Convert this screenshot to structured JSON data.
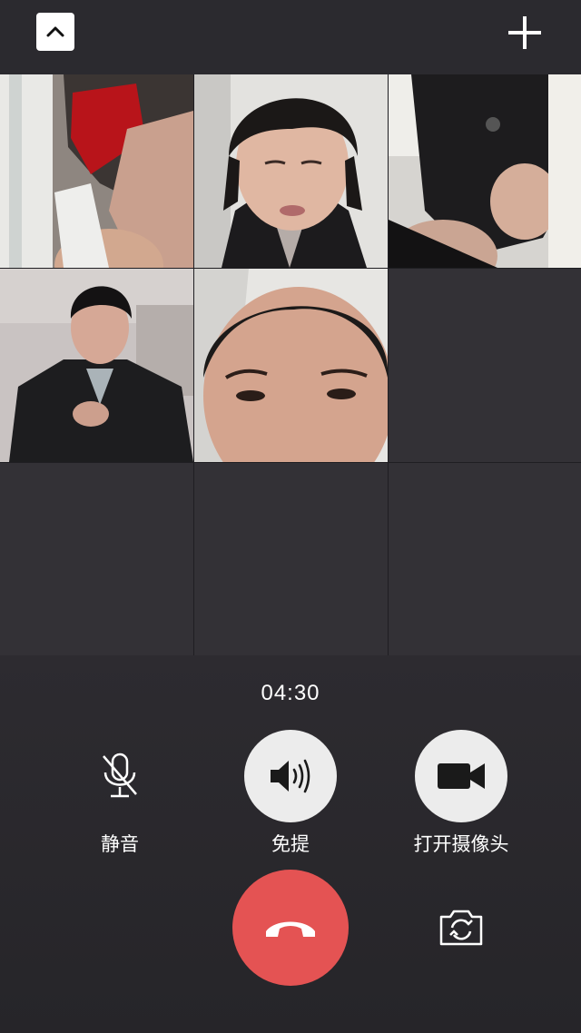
{
  "header": {
    "collapse_icon": "chevron-up-icon",
    "add_icon": "plus-icon"
  },
  "participants": [
    {
      "slot": 1,
      "video": "on"
    },
    {
      "slot": 2,
      "video": "on"
    },
    {
      "slot": 3,
      "video": "on"
    },
    {
      "slot": 4,
      "video": "on"
    },
    {
      "slot": 5,
      "video": "on"
    },
    {
      "slot": 6,
      "video": "empty"
    },
    {
      "slot": 7,
      "video": "empty"
    },
    {
      "slot": 8,
      "video": "empty"
    },
    {
      "slot": 9,
      "video": "empty"
    }
  ],
  "call": {
    "duration": "04:30"
  },
  "controls": {
    "mute_label": "静音",
    "mute_icon": "microphone-muted-icon",
    "speaker_label": "免提",
    "speaker_icon": "speaker-icon",
    "camera_label": "打开摄像头",
    "camera_icon": "video-camera-icon",
    "hangup_icon": "phone-hangup-icon",
    "switch_camera_icon": "switch-camera-icon"
  },
  "colors": {
    "hangup": "#e45353",
    "background": "#2a2a2d",
    "button_fill": "#ececec"
  }
}
